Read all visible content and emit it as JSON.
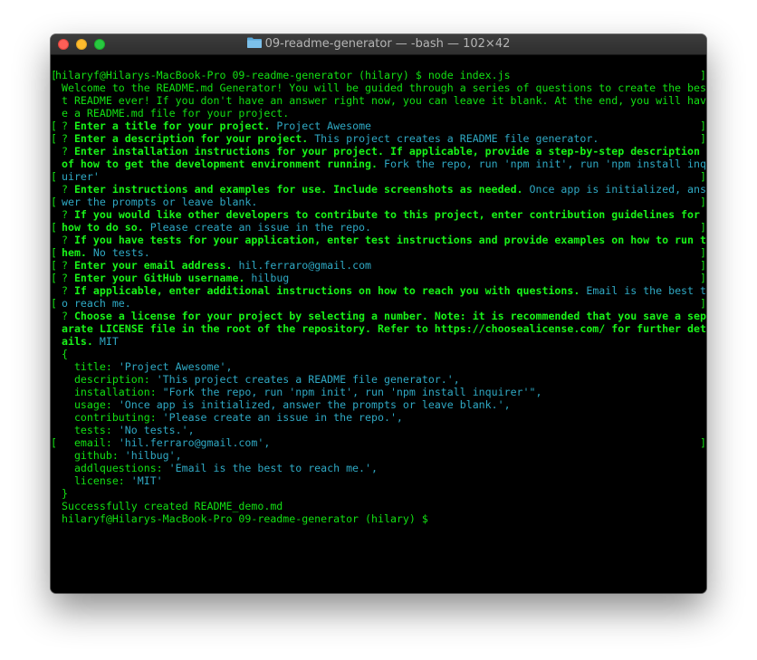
{
  "window": {
    "title": "09-readme-generator — -bash — 102×42"
  },
  "terminal": {
    "lines": [
      {
        "id": "l1",
        "text": "hilaryf@Hilarys-MacBook-Pro 09-readme-generator (hilary) $ node index.js",
        "lb": "[",
        "rb": "]"
      },
      {
        "id": "l2",
        "text": " Welcome to the README.md Generator! You will be guided through a series of questions to create the bes"
      },
      {
        "id": "l3",
        "text": " t README ever! If you don't have an answer right now, you can leave it blank. At the end, you will hav"
      },
      {
        "id": "l4",
        "text": " e a README.md file for your project."
      },
      {
        "id": "l5",
        "q": "?",
        "bold": "Enter a title for your project.",
        "ans": "Project Awesome",
        "lb": "[",
        "rb": "]"
      },
      {
        "id": "l6",
        "q": "?",
        "bold": "Enter a description for your project.",
        "ans": "This project creates a README file generator.",
        "lb": "[",
        "rb": "]"
      },
      {
        "id": "l7",
        "q": "?",
        "bold": "Enter installation instructions for your project. If applicable, provide a step-by-step description"
      },
      {
        "id": "l8",
        "bold": "of how to get the development environment running.",
        "ans": "Fork the repo, run 'npm init', run 'npm install inq"
      },
      {
        "id": "l9",
        "ans": "uirer'",
        "lb": "[",
        "rb": "]"
      },
      {
        "id": "l10",
        "q": "?",
        "bold": "Enter instructions and examples for use. Include screenshots as needed.",
        "ans": "Once app is initialized, ans"
      },
      {
        "id": "l11",
        "ans": "wer the prompts or leave blank.",
        "lb": "[",
        "rb": "]"
      },
      {
        "id": "l12",
        "q": "?",
        "bold": "If you would like other developers to contribute to this project, enter contribution guidelines for"
      },
      {
        "id": "l13",
        "bold": "how to do so.",
        "ans": "Please create an issue in the repo.",
        "lb": "[",
        "rb": "]"
      },
      {
        "id": "l14",
        "q": "?",
        "bold": "If you have tests for your application, enter test instructions and provide examples on how to run t"
      },
      {
        "id": "l15",
        "bold": "hem.",
        "ans": "No tests.",
        "lb": "[",
        "rb": "]"
      },
      {
        "id": "l16",
        "q": "?",
        "bold": "Enter your email address.",
        "ans": "hil.ferraro@gmail.com",
        "lb": "[",
        "rb": "]"
      },
      {
        "id": "l17",
        "q": "?",
        "bold": "Enter your GitHub username.",
        "ans": "hilbug",
        "lb": "[",
        "rb": "]"
      },
      {
        "id": "l18",
        "q": "?",
        "bold": "If applicable, enter additional instructions on how to reach you with questions.",
        "ans": "Email is the best t"
      },
      {
        "id": "l19",
        "ans": "o reach me.",
        "lb": "[",
        "rb": "]"
      },
      {
        "id": "l20",
        "q": "?",
        "bold": "Choose a license for your project by selecting a number. Note: it is recommended that you save a sep"
      },
      {
        "id": "l21",
        "bold": "arate LICENSE file in the root of the repository. Refer to https://choosealicense.com/ for further det"
      },
      {
        "id": "l22",
        "bold": "ails.",
        "ans": "MIT"
      },
      {
        "id": "l23",
        "text": " {"
      },
      {
        "id": "l24",
        "key": "   title: ",
        "val": "'Project Awesome',"
      },
      {
        "id": "l25",
        "key": "   description: ",
        "val": "'This project creates a README file generator.',"
      },
      {
        "id": "l26",
        "key": "   installation: ",
        "val": "\"Fork the repo, run 'npm init', run 'npm install inquirer'\","
      },
      {
        "id": "l27",
        "key": "   usage: ",
        "val": "'Once app is initialized, answer the prompts or leave blank.',"
      },
      {
        "id": "l28",
        "key": "   contributing: ",
        "val": "'Please create an issue in the repo.',"
      },
      {
        "id": "l29",
        "key": "   tests: ",
        "val": "'No tests.',"
      },
      {
        "id": "l30",
        "key": "   email: ",
        "val": "'hil.ferraro@gmail.com',",
        "lb": "[",
        "rb": "]"
      },
      {
        "id": "l31",
        "key": "   github: ",
        "val": "'hilbug',"
      },
      {
        "id": "l32",
        "key": "   addlquestions: ",
        "val": "'Email is the best to reach me.',"
      },
      {
        "id": "l33",
        "key": "   license: ",
        "val": "'MIT'"
      },
      {
        "id": "l34",
        "text": " }"
      },
      {
        "id": "l35",
        "text": " Successfully created README_demo.md"
      },
      {
        "id": "l36",
        "text": " hilaryf@Hilarys-MacBook-Pro 09-readme-generator (hilary) $"
      }
    ]
  },
  "colors": {
    "green": "#13e013",
    "bold_green": "#19f419",
    "answer_cyan": "#2fa9c4",
    "background": "#000000"
  },
  "icons": {
    "folder": "folder-icon"
  }
}
